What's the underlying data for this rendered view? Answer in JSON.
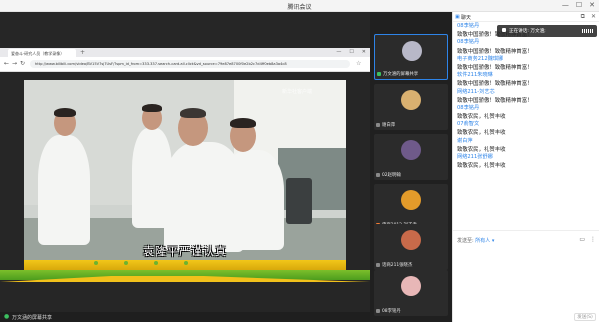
{
  "window": {
    "title": "腾讯会议",
    "controls": [
      "—",
      "☐",
      "✕"
    ]
  },
  "browser": {
    "tab_title": "爱奋斗·研究人员（教学录像）",
    "url": "http://www.bilibili.com/video/BV15V7sj7UsF/?spm_id_from=333.337.search-card.all.click&vd_source=79e87e8700f0e2b2c7d4ff0eb8a3a4c8",
    "nav": [
      "←",
      "→",
      "↻"
    ]
  },
  "video": {
    "watermark": "新华社客户端",
    "subtitle": "袁隆平严谨认真"
  },
  "share_bar": {
    "label": "万文涵的屏幕共享"
  },
  "participants": [
    {
      "name": "万文涵的屏幕共享",
      "mic": "on",
      "avatar_color": "#b8b8c8"
    },
    {
      "name": "谢白萍",
      "mic": "grey",
      "avatar_color": "#d9b070"
    },
    {
      "name": "02赵明翰",
      "mic": "grey",
      "avatar_color": "#6f5a8a"
    },
    {
      "name": "电商2012-刘子聿",
      "mic": "off",
      "avatar_color": "#e39b2a"
    },
    {
      "name": "话商211张晓杰",
      "mic": "grey",
      "avatar_color": "#c86a4a"
    },
    {
      "name": "08李铭丹",
      "mic": "grey",
      "avatar_color": "#e8b7b7"
    }
  ],
  "chat": {
    "title": "聊天",
    "speaking_label": "正在讲话: 万文涵;",
    "messages": [
      {
        "sender": "08李铭丹",
        "text": "致敬中国骄傲！致敬精神首富！"
      },
      {
        "sender": "08李铭丹",
        "text": "致敬中国骄傲！致敬精神首富！"
      },
      {
        "sender": "电子商务212魏琪娜",
        "text": "致敬中国骄傲！致敬精神首富！"
      },
      {
        "sender": "软件211朱晓琳",
        "text": "致敬中国骄傲！致敬精神首富！"
      },
      {
        "sender": "网络211-刘艺芯",
        "text": "致敬中国骄傲！致敬精神首富！"
      },
      {
        "sender": "08李铭丹",
        "text": "致敬农民，礼赞丰收"
      },
      {
        "sender": "07俞智文",
        "text": "致敬农民，礼赞丰收"
      },
      {
        "sender": "谢白萍",
        "text": "致敬农民，礼赞丰收"
      },
      {
        "sender": "网络211张舒娜",
        "text": "致敬农民，礼赞丰收"
      }
    ],
    "send_to_label": "发送至:",
    "send_to_value": "所有人 ▾",
    "send_button": "发送(S)"
  },
  "colors": {
    "accent": "#2e84e8",
    "share_bg": "#262626",
    "sidebar_bg": "#202020",
    "mic_on": "#3cc060"
  }
}
